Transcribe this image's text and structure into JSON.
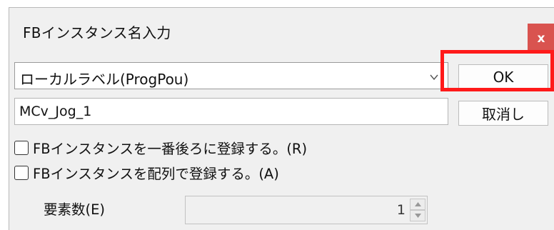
{
  "window": {
    "title": "FBインスタンス名入力",
    "close_label": "x"
  },
  "combo": {
    "selected": "ローカルラベル(ProgPou)",
    "icon": "chevron-down-icon"
  },
  "instance_name": {
    "value": "MCv_Jog_1"
  },
  "buttons": {
    "ok": "OK",
    "cancel": "取消し"
  },
  "options": {
    "register_last": {
      "label": "FBインスタンスを一番後ろに登録する。(R)",
      "checked": false
    },
    "register_array": {
      "label": "FBインスタンスを配列で登録する。(A)",
      "checked": false
    }
  },
  "element_count": {
    "label": "要素数(E)",
    "value": "1",
    "up_icon": "spin-up-icon",
    "down_icon": "spin-down-icon"
  },
  "highlight_color": "#ff1a1a",
  "close_color": "#d9534f"
}
